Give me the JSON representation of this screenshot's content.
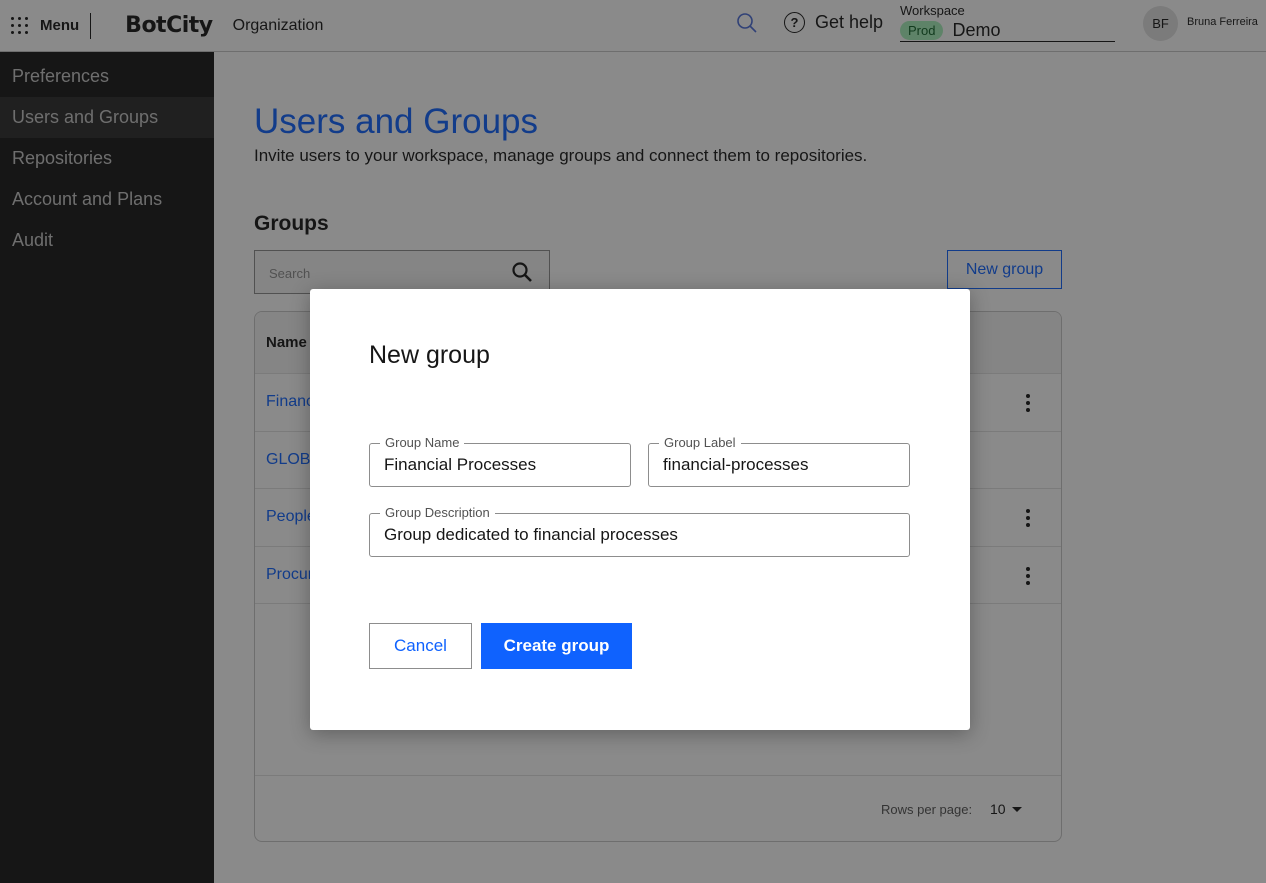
{
  "header": {
    "menu_label": "Menu",
    "logo": "BotCity",
    "org_label": "Organization",
    "help_label": "Get help",
    "workspace_label": "Workspace",
    "workspace_badge": "Prod",
    "workspace_value": "Demo",
    "avatar_initials": "BF",
    "user_name": "Bruna Ferreira"
  },
  "sidebar": {
    "items": [
      {
        "label": "Preferences"
      },
      {
        "label": "Users and Groups"
      },
      {
        "label": "Repositories"
      },
      {
        "label": "Account and Plans"
      },
      {
        "label": "Audit"
      }
    ]
  },
  "main": {
    "title": "Users and Groups",
    "subtitle": "Invite users to your workspace, manage groups and connect them to repositories.",
    "section_title": "Groups",
    "search_placeholder": "Search",
    "new_group_label": "New group",
    "table": {
      "column_name": "Name",
      "rows": [
        "Financ",
        "GLOBA",
        "People",
        "Procur"
      ]
    },
    "rows_per_page_label": "Rows per page:",
    "rows_per_page_value": "10"
  },
  "modal": {
    "title": "New group",
    "group_name_label": "Group Name",
    "group_name_value": "Financial Processes",
    "group_label_label": "Group Label",
    "group_label_value": "financial-processes",
    "group_description_label": "Group Description",
    "group_description_value": "Group dedicated to financial processes",
    "cancel_label": "Cancel",
    "create_label": "Create group"
  },
  "colors": {
    "accent": "#0f62fe",
    "sidebar_bg": "#161616",
    "prod_badge_bg": "#a7f0ba"
  }
}
